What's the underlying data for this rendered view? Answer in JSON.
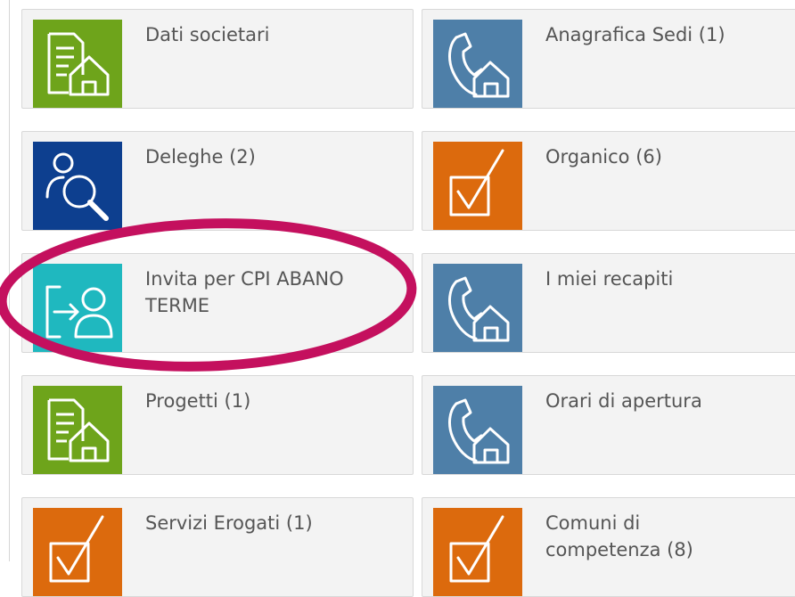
{
  "colors": {
    "green": "#6ea41b",
    "steel": "#4e7fa8",
    "navy": "#0d3f8f",
    "orange": "#dc6a0d",
    "teal": "#1fb8bf",
    "highlight": "#c4105e"
  },
  "tiles": [
    {
      "label": "Dati societari",
      "icon": "document-house-icon",
      "color": "green"
    },
    {
      "label": "Anagrafica Sedi (1)",
      "icon": "phone-house-icon",
      "color": "steel"
    },
    {
      "label": "Deleghe (2)",
      "icon": "person-search-icon",
      "color": "navy"
    },
    {
      "label": "Organico (6)",
      "icon": "checkbox-icon",
      "color": "orange"
    },
    {
      "label": "Invita per CPI ABANO TERME",
      "icon": "invite-person-icon",
      "color": "teal"
    },
    {
      "label": "I miei recapiti",
      "icon": "phone-house-icon",
      "color": "steel"
    },
    {
      "label": "Progetti (1)",
      "icon": "document-house-icon",
      "color": "green"
    },
    {
      "label": "Orari di apertura",
      "icon": "phone-house-icon",
      "color": "steel"
    },
    {
      "label": "Servizi Erogati (1)",
      "icon": "checkbox-icon",
      "color": "orange"
    },
    {
      "label": "Comuni di competenza (8)",
      "icon": "checkbox-icon",
      "color": "orange"
    }
  ]
}
